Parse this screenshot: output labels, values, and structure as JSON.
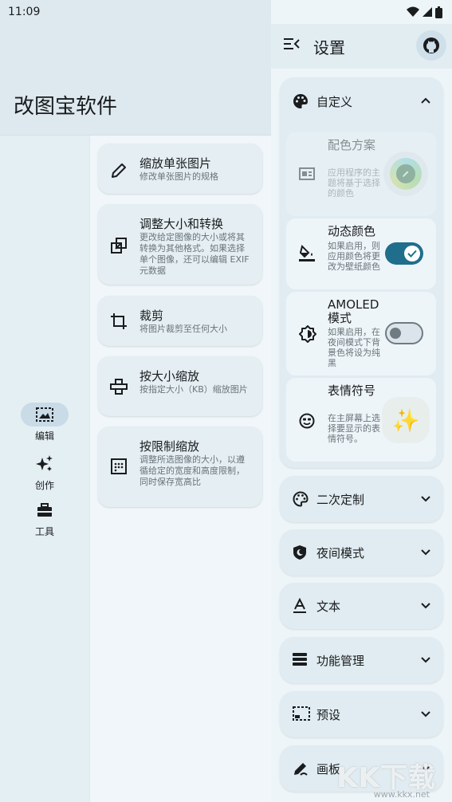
{
  "status_bar": {
    "time": "11:09"
  },
  "app": {
    "title": "改图宝软件"
  },
  "nav": [
    {
      "label": "编辑",
      "icon": "image-edit-icon",
      "active": true
    },
    {
      "label": "创作",
      "icon": "sparkles-icon",
      "active": false
    },
    {
      "label": "工具",
      "icon": "toolbox-icon",
      "active": false
    }
  ],
  "tools": [
    {
      "title": "缩放单张图片",
      "desc": "修改单张图片的规格",
      "icon": "pencil-icon"
    },
    {
      "title": "调整大小和转换",
      "desc": "更改给定图像的大小或将其转换为其他格式。如果选择单个图像，还可以编辑 EXIF 元数据",
      "icon": "resize-convert-icon"
    },
    {
      "title": "裁剪",
      "desc": "将图片裁剪至任何大小",
      "icon": "crop-icon"
    },
    {
      "title": "按大小缩放",
      "desc": "按指定大小（KB）缩放图片",
      "icon": "weight-icon"
    },
    {
      "title": "按限制缩放",
      "desc": "调整所选图像的大小，以遵循给定的宽度和高度限制，同时保存宽高比",
      "icon": "limit-grid-icon"
    }
  ],
  "settings": {
    "title": "设置",
    "expanded_section": {
      "label": "自定义",
      "items": [
        {
          "title": "配色方案",
          "desc": "应用程序的主题将基于选择的颜色",
          "disabled": true
        },
        {
          "title": "动态颜色",
          "desc": "如果启用，则应用颜色将更改为壁纸颜色",
          "toggle": true
        },
        {
          "title": "AMOLED 模式",
          "desc": "如果启用，在夜间模式下背景色将设为纯黑",
          "toggle": false
        },
        {
          "title": "表情符号",
          "desc": "在主屏幕上选择要显示的表情符号。",
          "emoji": "✨"
        }
      ]
    },
    "sections": [
      {
        "label": "二次定制",
        "icon": "palette-outline-icon"
      },
      {
        "label": "夜间模式",
        "icon": "night-shield-icon"
      },
      {
        "label": "文本",
        "icon": "text-icon"
      },
      {
        "label": "功能管理",
        "icon": "feature-list-icon"
      },
      {
        "label": "预设",
        "icon": "preset-frame-icon"
      },
      {
        "label": "画板",
        "icon": "draw-icon"
      }
    ]
  },
  "watermark": {
    "main": "KK下载",
    "sub": "www.kkx.net"
  },
  "colors": {
    "accent": "#1f6e8c",
    "card": "#e4eef3"
  }
}
